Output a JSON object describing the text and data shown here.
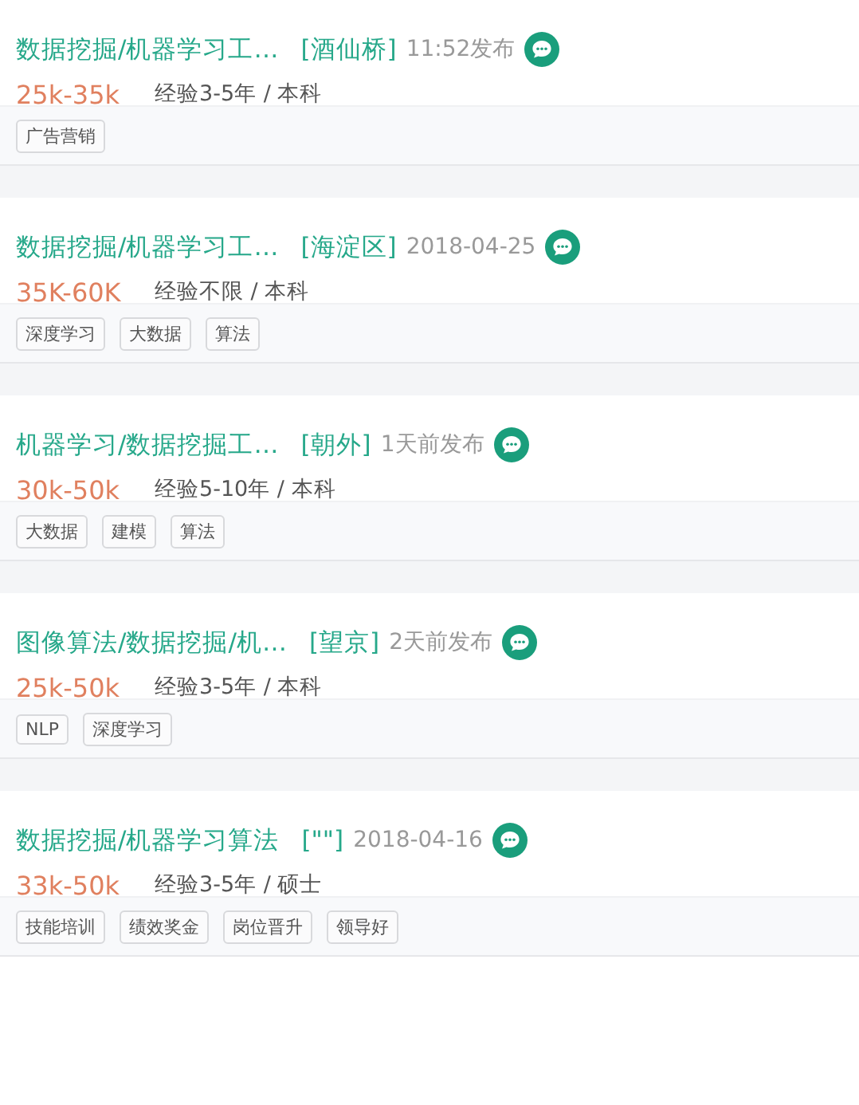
{
  "jobs": [
    {
      "title": "数据挖掘/机器学习工…",
      "location": "[酒仙桥]",
      "time": "11:52发布",
      "salary": "25k-35k",
      "requirements": "经验3-5年 / 本科",
      "tags": [
        "广告营销"
      ]
    },
    {
      "title": "数据挖掘/机器学习工…",
      "location": "[海淀区]",
      "time": "2018-04-25",
      "salary": "35K-60K",
      "requirements": "经验不限 / 本科",
      "tags": [
        "深度学习",
        "大数据",
        "算法"
      ]
    },
    {
      "title": "机器学习/数据挖掘工…",
      "location": "[朝外]",
      "time": "1天前发布",
      "salary": "30k-50k",
      "requirements": "经验5-10年 / 本科",
      "tags": [
        "大数据",
        "建模",
        "算法"
      ]
    },
    {
      "title": "图像算法/数据挖掘/机…",
      "location": "[望京]",
      "time": "2天前发布",
      "salary": "25k-50k",
      "requirements": "经验3-5年 / 本科",
      "tags": [
        "NLP",
        "深度学习"
      ]
    },
    {
      "title": "数据挖掘/机器学习算法",
      "location": "[\"\"]",
      "time": "2018-04-16",
      "salary": "33k-50k",
      "requirements": "经验3-5年 / 硕士",
      "tags": [
        "技能培训",
        "绩效奖金",
        "岗位晋升",
        "领导好"
      ]
    }
  ]
}
